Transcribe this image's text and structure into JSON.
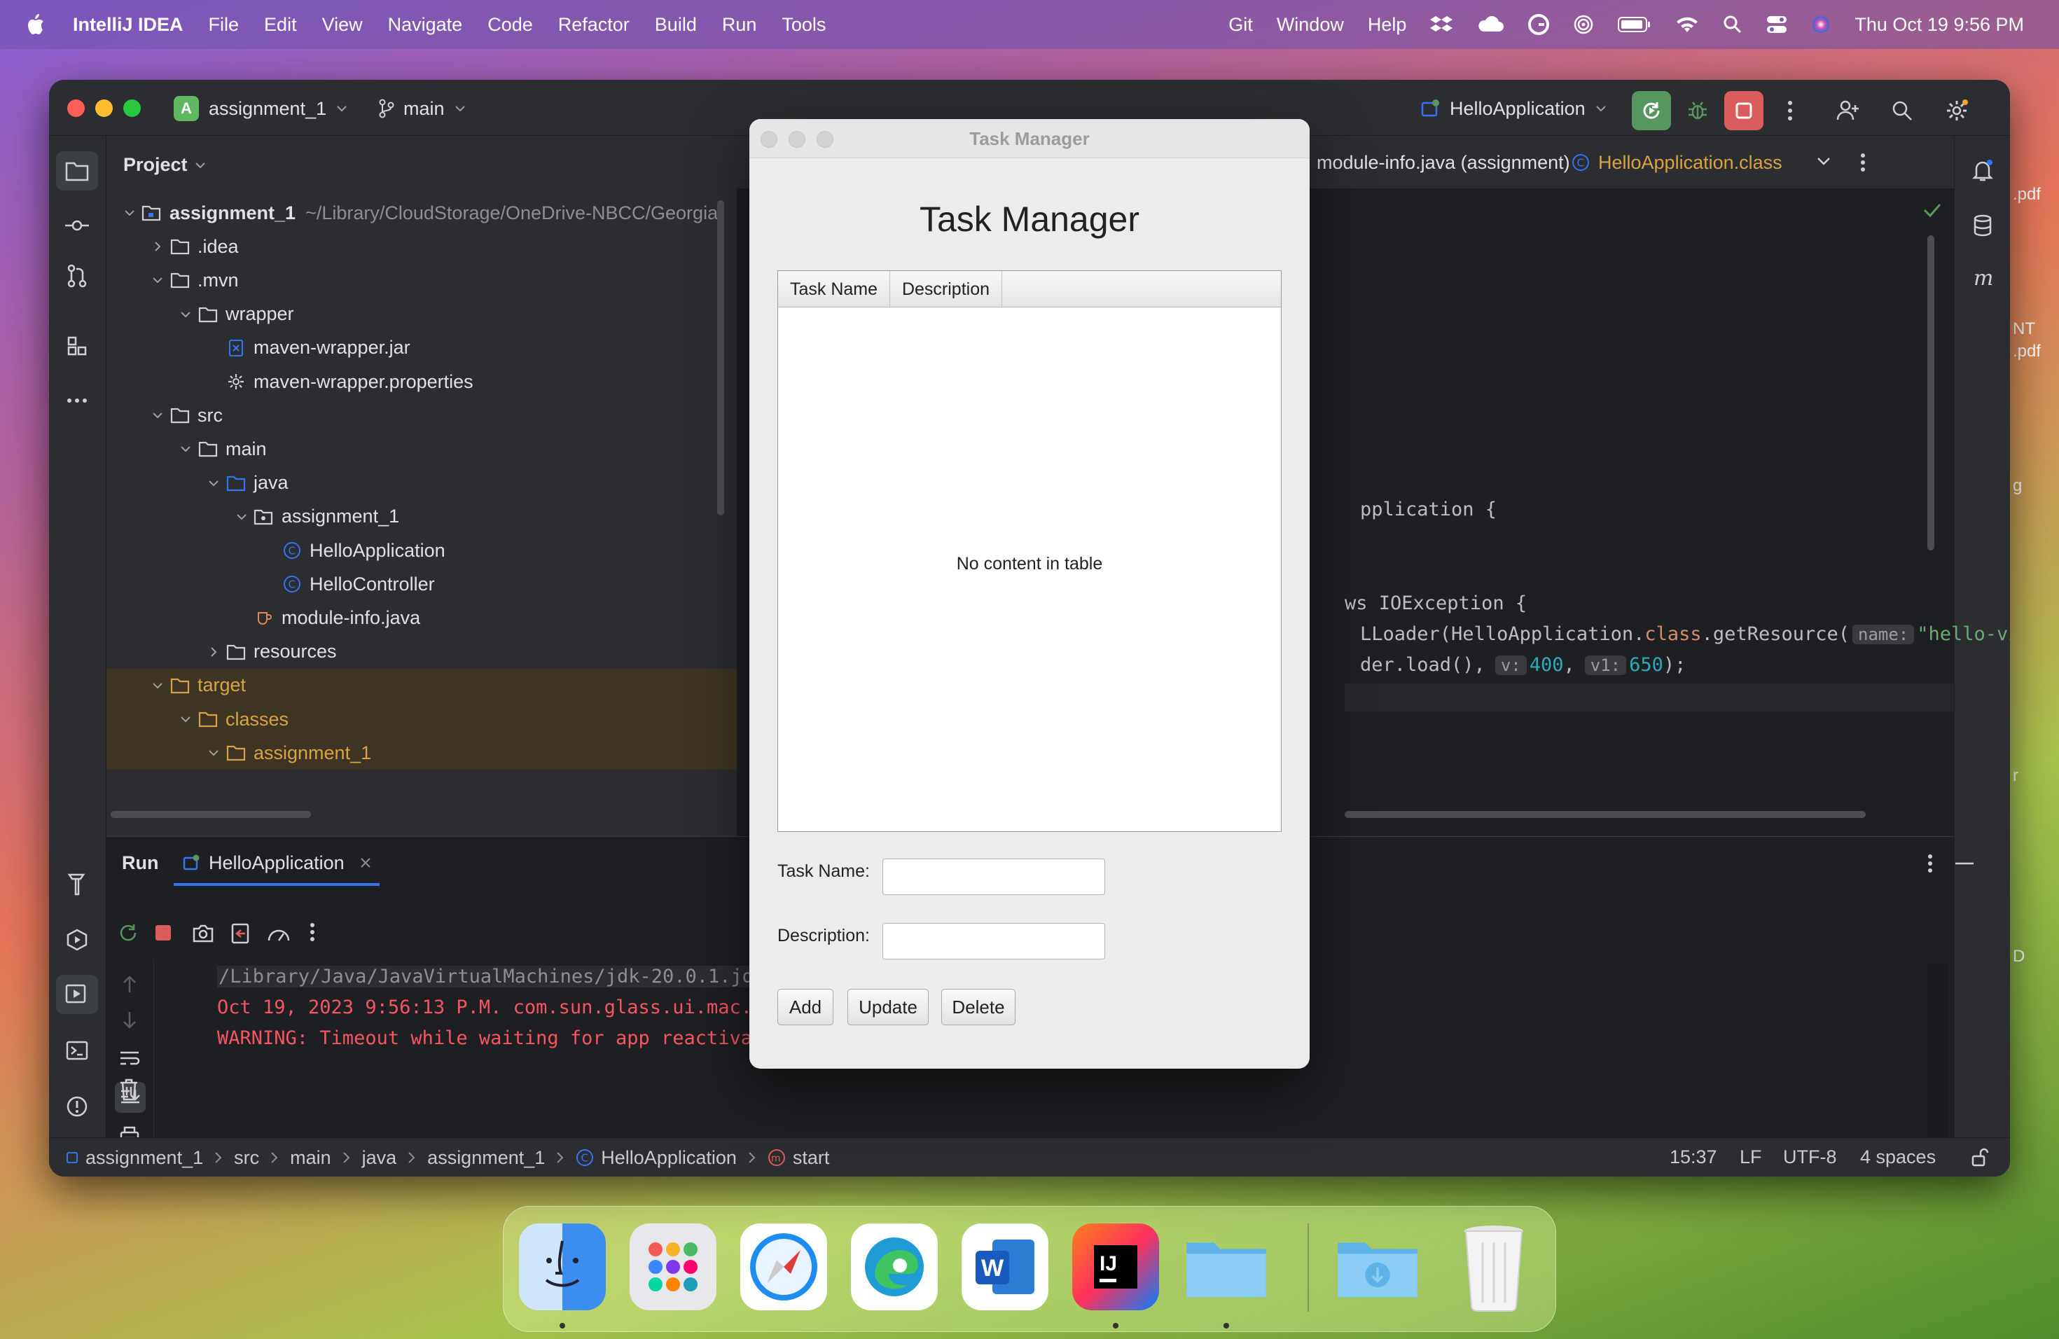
{
  "menubar": {
    "app": "IntelliJ IDEA",
    "items": [
      "File",
      "Edit",
      "View",
      "Navigate",
      "Code",
      "Refactor",
      "Build",
      "Run",
      "Tools"
    ],
    "right_items": [
      "Git",
      "Window",
      "Help"
    ],
    "datetime": "Thu Oct 19  9:56 PM"
  },
  "desktop": {
    "edge_labels": [
      ".pdf",
      "NT",
      ".pdf",
      "g",
      "r",
      "D"
    ]
  },
  "ide": {
    "project": {
      "badge": "A",
      "name": "assignment_1"
    },
    "branch": "main",
    "run_config": "HelloApplication",
    "panel_title": "Project",
    "tree": [
      {
        "label": "assignment_1",
        "extra": "~/Library/CloudStorage/OneDrive-NBCC/Georgia"
      },
      {
        "label": ".idea"
      },
      {
        "label": ".mvn"
      },
      {
        "label": "wrapper"
      },
      {
        "label": "maven-wrapper.jar"
      },
      {
        "label": "maven-wrapper.properties"
      },
      {
        "label": "src"
      },
      {
        "label": "main"
      },
      {
        "label": "java"
      },
      {
        "label": "assignment_1"
      },
      {
        "label": "HelloApplication"
      },
      {
        "label": "HelloController"
      },
      {
        "label": "module-info.java"
      },
      {
        "label": "resources"
      },
      {
        "label": "target"
      },
      {
        "label": "classes"
      },
      {
        "label": "assignment_1"
      }
    ],
    "editor_tabs": [
      {
        "label": "module-info.java (assignment)"
      },
      {
        "label": "HelloApplication.class"
      }
    ],
    "code": [
      {
        "text": "pplication {"
      },
      {
        "text": "ws IOException {"
      },
      {
        "pre": "LLoader(HelloApplication.",
        "kw": "class",
        "mid": ".getResource(",
        "hint": "name:",
        "str": "\"hello-vie"
      },
      {
        "pre": "der.load(),",
        "hint1": "v:",
        "n1": "400",
        "sep": ",",
        "hint2": "v1:",
        "n2": "650",
        "post": ");"
      }
    ],
    "run": {
      "label": "Run",
      "tab": "HelloApplication",
      "console": [
        "/Library/Java/JavaVirtualMachines/jdk-20.0.1.jdk/Cont",
        "Oct 19, 2023 9:56:13 P.M. com.sun.glass.ui.mac.MacApp",
        "WARNING: Timeout while waiting for app reactivation"
      ]
    },
    "breadcrumbs": [
      "assignment_1",
      "src",
      "main",
      "java",
      "assignment_1",
      "HelloApplication",
      "start"
    ],
    "status": {
      "position": "15:37",
      "line_sep": "LF",
      "encoding": "UTF-8",
      "indent": "4 spaces"
    }
  },
  "task_manager": {
    "window_title": "Task Manager",
    "heading": "Task Manager",
    "columns": [
      "Task Name",
      "Description"
    ],
    "empty_text": "No content in table",
    "fields": [
      {
        "label": "Task Name:",
        "value": ""
      },
      {
        "label": "Description:",
        "value": ""
      }
    ],
    "buttons": [
      "Add",
      "Update",
      "Delete"
    ]
  },
  "colors": {
    "accent": "#3574f0",
    "error_text": "#f75464",
    "number": "#2aacb8",
    "keyword": "#cf8e6d",
    "string": "#6aab73",
    "run_green": "#57965c",
    "stop_red": "#db5c5c"
  }
}
